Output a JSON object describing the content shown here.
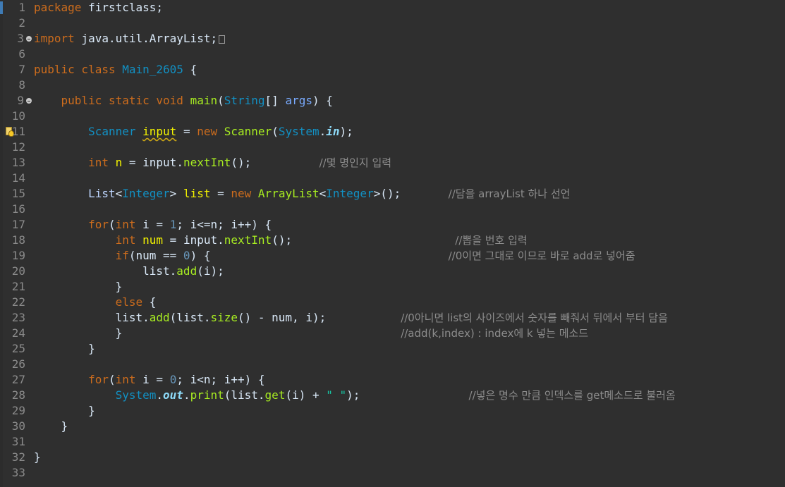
{
  "editor": {
    "language": "java",
    "colors": {
      "background": "#2f2f2f",
      "keyword": "#cc6c1d",
      "type": "#1290c3",
      "method": "#a7ec21",
      "comment": "#8c8c8c",
      "number": "#6897bb",
      "string": "#17c6a3"
    },
    "gutter": {
      "line_numbers": [
        "1",
        "2",
        "3",
        "6",
        "7",
        "8",
        "9",
        "10",
        "11",
        "12",
        "13",
        "14",
        "15",
        "16",
        "17",
        "18",
        "19",
        "20",
        "21",
        "22",
        "23",
        "24",
        "25",
        "26",
        "27",
        "28",
        "29",
        "30",
        "31",
        "32",
        "33"
      ],
      "fold_markers": [
        "3",
        "9"
      ],
      "warning_marker": "11"
    },
    "lines": {
      "l1": {
        "pkg": "package",
        "name": " firstclass;"
      },
      "l3": {
        "imp": "import",
        "path": " java.util.ArrayList;"
      },
      "l7": {
        "pub": "public",
        "cls": " class ",
        "name": "Main_2605",
        "brace": " {"
      },
      "l9": {
        "pub": "    public",
        "stat": " static",
        "void": " void",
        "sp": " ",
        "main": "main",
        "p1": "(",
        "str": "String",
        "p2": "[] ",
        "args": "args",
        "p3": ") {"
      },
      "l11": {
        "ind": "        ",
        "scanner": "Scanner",
        "sp": " ",
        "input": "input",
        "eq": " = ",
        "new": "new",
        "sp2": " ",
        "ctor": "Scanner",
        "p1": "(",
        "system": "System",
        "dot": ".",
        "in": "in",
        "p2": ");"
      },
      "l13": {
        "ind": "        ",
        "int": "int",
        "sp": " ",
        "n": "n",
        "eq": " = input.",
        "call": "nextInt",
        "p": "();",
        "gap": "          ",
        "comment": "//몇 명인지 입력"
      },
      "l15": {
        "ind": "        ",
        "list": "List",
        "lt": "<",
        "integer": "Integer",
        "gt": "> ",
        "var": "list",
        "eq": " = ",
        "new": "new",
        "sp": " ",
        "arraylist": "ArrayList",
        "lt2": "<",
        "integer2": "Integer",
        "gt2": ">();",
        "gap": "       ",
        "comment": "//담을 arrayList 하나 선언"
      },
      "l17": {
        "ind": "        ",
        "for": "for",
        "p": "(",
        "int": "int",
        "rest1": " i = ",
        "one": "1",
        "rest2": "; i<=n; i++) {"
      },
      "l18": {
        "ind": "            ",
        "int": "int",
        "sp": " ",
        "num": "num",
        "eq": " = input.",
        "call": "nextInt",
        "p": "();",
        "gap": "                        ",
        "comment": "//뽑을 번호 입력"
      },
      "l19": {
        "ind": "            ",
        "if": "if",
        "p1": "(num == ",
        "zero": "0",
        "p2": ") {",
        "gap": "                                   ",
        "comment": "//0이면 그대로 이므로 바로 add로 넣어줌"
      },
      "l20": {
        "ind": "                ",
        "list": "list.",
        "add": "add",
        "rest": "(i);"
      },
      "l21": {
        "text": "            }"
      },
      "l22": {
        "ind": "            ",
        "else": "else",
        "rest": " {"
      },
      "l23": {
        "ind": "            ",
        "l1": "list.",
        "add": "add",
        "l2": "(list.",
        "size": "size",
        "rest": "() - num, i);",
        "gap": "           ",
        "comment": "//0아니면 list의 사이즈에서 숫자를 빼줘서 뒤에서 부터 담음"
      },
      "l24": {
        "ind": "            ",
        "brace": "}",
        "gap": "                                         ",
        "comment": "//add(k,index) : index에 k 넣는 메소드"
      },
      "l25": {
        "text": "        }"
      },
      "l27": {
        "ind": "        ",
        "for": "for",
        "p": "(",
        "int": "int",
        "rest1": " i = ",
        "zero": "0",
        "rest2": "; i<n; i++) {"
      },
      "l28": {
        "ind": "            ",
        "system": "System",
        "dot": ".",
        "out": "out",
        "dot2": ".",
        "print": "print",
        "p1": "(list.",
        "get": "get",
        "p2": "(i) + ",
        "str": "\" \"",
        "p3": ");",
        "gap": "                ",
        "comment": "//넣은 명수 만큼 인덱스를 get메소드로 불러옴"
      },
      "l29": {
        "text": "        }"
      },
      "l30": {
        "text": "    }"
      },
      "l32": {
        "text": "}"
      }
    }
  }
}
